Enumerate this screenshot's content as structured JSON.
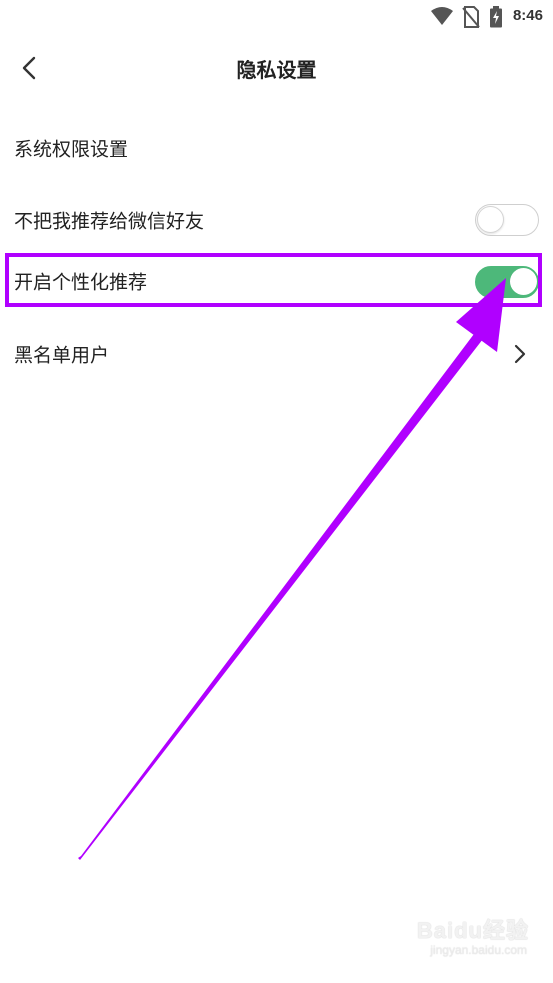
{
  "status_bar": {
    "time": "8:46",
    "icons": [
      "wifi-icon",
      "no-sim-icon",
      "battery-charging-icon"
    ]
  },
  "header": {
    "title": "隐私设置",
    "back_icon": "chevron-left-icon"
  },
  "settings": {
    "items": [
      {
        "label": "系统权限设置",
        "control": "none"
      },
      {
        "label": "不把我推荐给微信好友",
        "control": "toggle",
        "enabled": false
      },
      {
        "label": "开启个性化推荐",
        "control": "toggle",
        "enabled": true
      },
      {
        "label": "黑名单用户",
        "control": "chevron",
        "icon": "chevron-right-icon"
      }
    ]
  },
  "annotation": {
    "color": "#b000ff",
    "target": "开启个性化推荐"
  },
  "colors": {
    "toggle_on": "#4db87a",
    "toggle_off_border": "#cfcfcf",
    "text": "#222222"
  },
  "watermark": {
    "logo": "Baidu经验",
    "url": "jingyan.baidu.com"
  }
}
